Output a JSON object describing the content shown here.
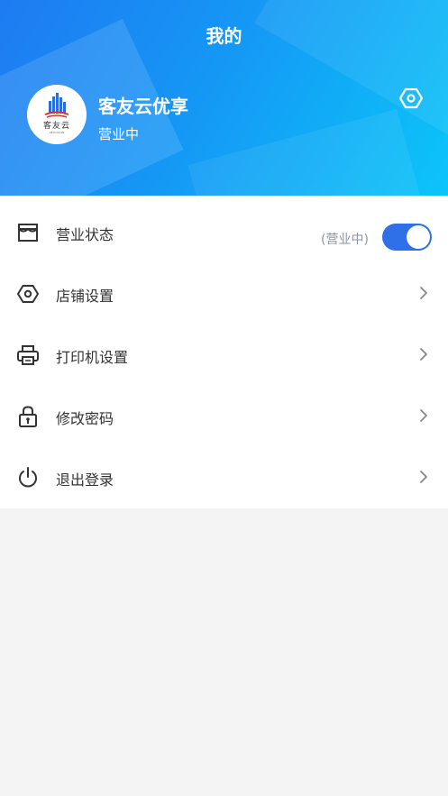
{
  "header": {
    "title": "我的",
    "store_name": "客友云优享",
    "store_status": "营业中",
    "avatar_logo_text": "客友云",
    "avatar_logo_sub": "KEYOUYUN",
    "settings_icon": "hexagon-gear-icon"
  },
  "menu": {
    "items": [
      {
        "label": "营业状态",
        "icon": "storefront-icon",
        "note": "(营业中)",
        "toggle_on": true
      },
      {
        "label": "店铺设置",
        "icon": "hexagon-gear-icon"
      },
      {
        "label": "打印机设置",
        "icon": "printer-icon"
      },
      {
        "label": "修改密码",
        "icon": "lock-icon"
      },
      {
        "label": "退出登录",
        "icon": "power-icon"
      }
    ]
  },
  "colors": {
    "accent": "#2f6fe8",
    "header_start": "#1e7bf2",
    "header_end": "#0bc5f8",
    "text": "#333333",
    "muted": "#8a94a6"
  }
}
